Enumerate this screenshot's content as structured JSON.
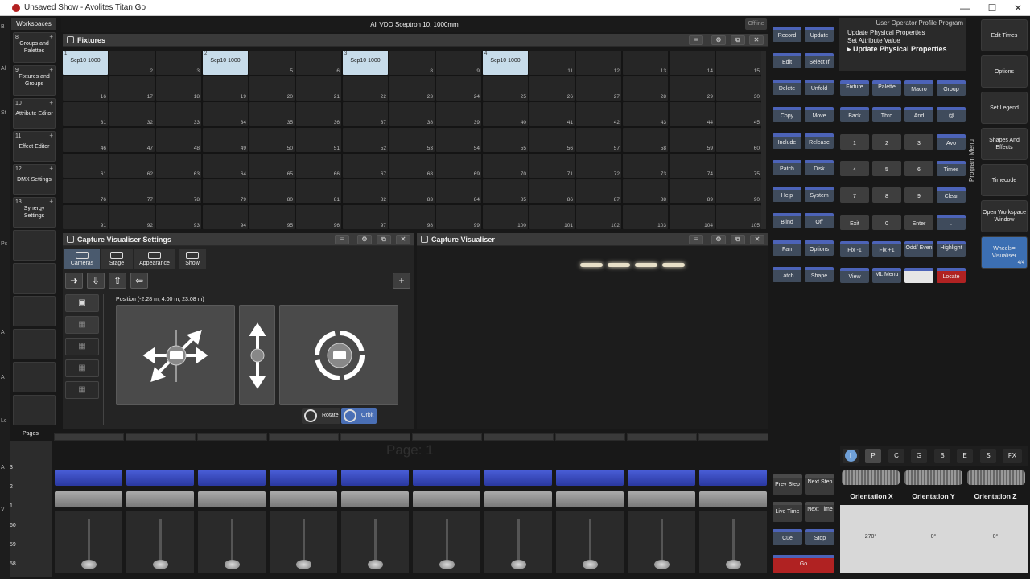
{
  "window": {
    "title": "Unsaved Show - Avolites Titan Go",
    "minimize": "—",
    "maximize": "☐",
    "close": "✕"
  },
  "workspace": {
    "header": "Workspaces",
    "items": [
      {
        "num": "8",
        "label": "Groups and Palettes"
      },
      {
        "num": "9",
        "label": "Fixtures and Groups"
      },
      {
        "num": "10",
        "label": "Attribute Editor"
      },
      {
        "num": "11",
        "label": "Effect Editor"
      },
      {
        "num": "12",
        "label": "DMX Settings"
      },
      {
        "num": "13",
        "label": "Synergy Settings"
      }
    ]
  },
  "status": {
    "text": "All VDO Sceptron 10, 1000mm",
    "offline": "Offline"
  },
  "fixtures": {
    "title": "Fixtures",
    "selected": [
      {
        "index": 1,
        "fixture_no": "1",
        "label": "Scp10 1000"
      },
      {
        "index": 4,
        "fixture_no": "2",
        "label": "Scp10 1000"
      },
      {
        "index": 7,
        "fixture_no": "3",
        "label": "Scp10 1000"
      },
      {
        "index": 10,
        "fixture_no": "4",
        "label": "Scp10 1000"
      }
    ],
    "cell_count": 105
  },
  "capture_settings": {
    "title": "Capture Visualiser Settings",
    "tabs": [
      "Cameras",
      "Stage",
      "Appearance",
      "Show"
    ],
    "position": "Position (-2.28 m, 4.00 m, 23.08 m)",
    "add": "+",
    "rotate": "Rotate",
    "orbit": "Orbit"
  },
  "visualiser": {
    "title": "Capture Visualiser"
  },
  "control_buttons": [
    {
      "label": "Record",
      "style": "blue"
    },
    {
      "label": "Update",
      "style": "blue"
    },
    {
      "label": "Edit",
      "style": "blue"
    },
    {
      "label": "Select If",
      "style": "blue"
    },
    {
      "label": "Delete",
      "style": "blue"
    },
    {
      "label": "Unfold",
      "style": "blue"
    },
    {
      "label": "Copy",
      "style": "blue"
    },
    {
      "label": "Move",
      "style": "blue"
    },
    {
      "label": "Include",
      "style": "blue"
    },
    {
      "label": "Release",
      "style": "blue"
    },
    {
      "label": "Patch",
      "style": "blue"
    },
    {
      "label": "Disk",
      "style": "blue"
    },
    {
      "label": "Help",
      "style": "blue"
    },
    {
      "label": "System",
      "style": "blue"
    },
    {
      "label": "Blind",
      "style": "blue"
    },
    {
      "label": "Off",
      "style": "blue"
    },
    {
      "label": "Fan",
      "style": "blue"
    },
    {
      "label": "Options",
      "style": "blue"
    },
    {
      "label": "Latch",
      "style": "blue"
    },
    {
      "label": "Shape",
      "style": "blue"
    }
  ],
  "keypad": [
    [
      "Fixture",
      "Palette",
      "Macro",
      "Group"
    ],
    [
      "Back",
      "Thro",
      "And",
      "@"
    ],
    [
      "1",
      "2",
      "3",
      "Avo"
    ],
    [
      "4",
      "5",
      "6",
      "Times"
    ],
    [
      "7",
      "8",
      "9",
      "Clear"
    ],
    [
      "Exit",
      "0",
      "Enter",
      "."
    ],
    [
      "Fix -1",
      "Fix +1",
      "Odd/ Even",
      "Highlight"
    ],
    [
      "View",
      "ML Menu",
      "",
      "Locate"
    ]
  ],
  "program_menu": {
    "tabs": "User  Operator  Profile  Program",
    "lines": [
      "Update Physical Properties",
      "Set Attribute Value",
      "▸ Update Physical Properties"
    ],
    "vertical": "Program Menu"
  },
  "right_menu": [
    "Edit Times",
    "Options",
    "Set Legend",
    "Shapes And Effects",
    "Timecode",
    "Open Workspace Window",
    "Wheels= Visualiser"
  ],
  "right_menu_page": "4/4",
  "pages": {
    "label": "Pages",
    "watermark": "Page: 1",
    "numbers": [
      "3",
      "2",
      "1",
      "60",
      "59",
      "58"
    ]
  },
  "playback": {
    "prev_step": "Prev Step",
    "next_step": "Next Step",
    "live_time": "Live Time",
    "next_time": "Next Time",
    "cue": "Cue",
    "stop": "Stop",
    "go": "Go"
  },
  "attribute_tabs": [
    "I",
    "P",
    "C",
    "G",
    "B",
    "E",
    "S",
    "FX"
  ],
  "encoders": [
    {
      "label": "Orientation X",
      "value": "270°"
    },
    {
      "label": "Orientation Y",
      "value": "0°"
    },
    {
      "label": "Orientation Z",
      "value": "0°"
    }
  ],
  "left_strip_letters": [
    "B",
    "Al",
    "St",
    "Pc",
    "A",
    "A",
    "Lc",
    "A",
    "V"
  ]
}
